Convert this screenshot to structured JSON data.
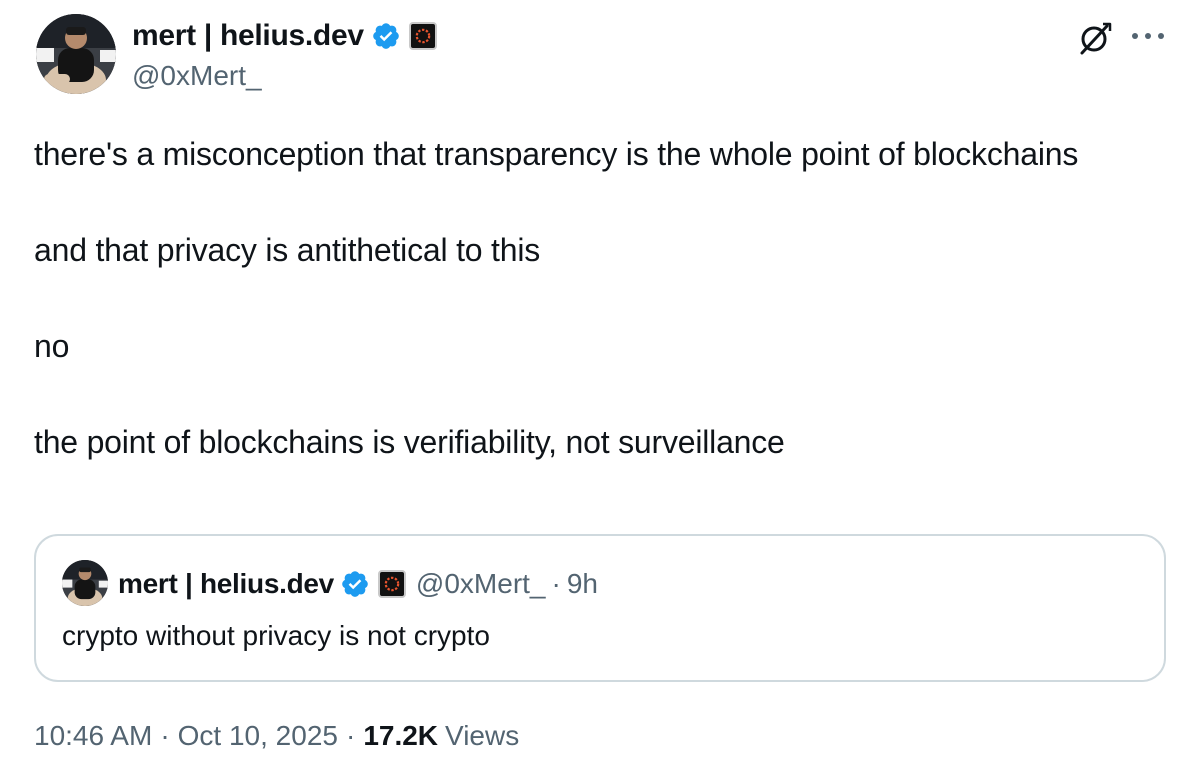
{
  "author": {
    "display_name": "mert | helius.dev",
    "handle": "@0xMert_"
  },
  "tweet": {
    "paragraphs": [
      "there's a misconception that transparency is the whole point of blockchains",
      "and that privacy is antithetical to this",
      "no",
      "the point of blockchains is verifiability, not surveillance"
    ]
  },
  "quoted": {
    "display_name": "mert | helius.dev",
    "handle": "@0xMert_",
    "separator": "·",
    "time": "9h",
    "text": "crypto without privacy is not crypto"
  },
  "meta": {
    "time": "10:46 AM",
    "separator": "·",
    "date": "Oct 10, 2025",
    "views_count": "17.2K",
    "views_label": "Views"
  },
  "icons": {
    "verified": "verified-badge-icon",
    "affiliate": "affiliate-badge-icon",
    "grok": "grok-icon",
    "more": "more-icon"
  },
  "colors": {
    "text_primary": "#0f1419",
    "text_secondary": "#536471",
    "verified_blue": "#1d9bf0",
    "card_border": "#cfd9de",
    "affiliate_accent": "#e8542e"
  }
}
